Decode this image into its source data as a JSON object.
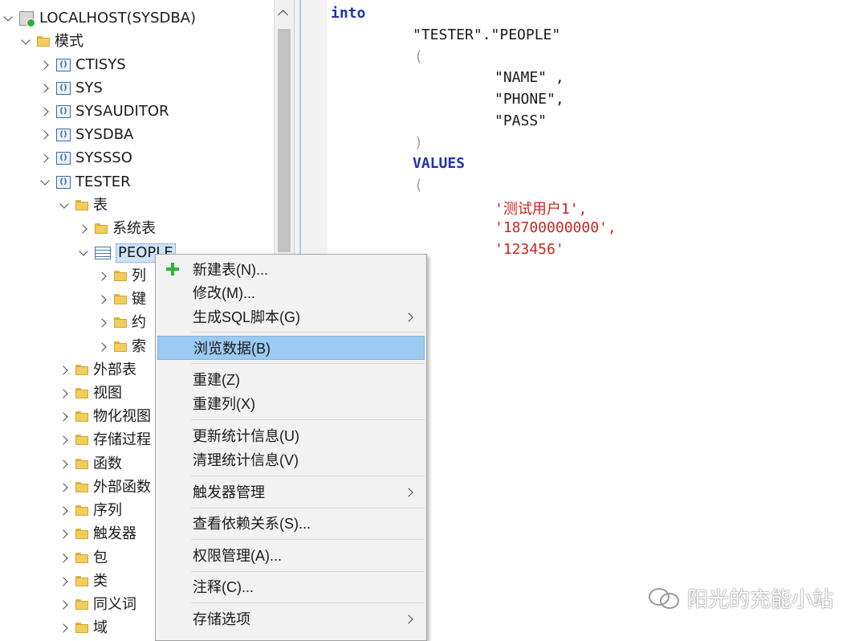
{
  "tree": {
    "root": {
      "label": "LOCALHOST(SYSDBA)",
      "icon": "server-icon"
    },
    "items": [
      {
        "label": "模式",
        "icon": "folder-icon",
        "expanded": true
      },
      {
        "label": "CTISYS",
        "icon": "schema-icon",
        "expanded": false
      },
      {
        "label": "SYS",
        "icon": "schema-icon",
        "expanded": false
      },
      {
        "label": "SYSAUDITOR",
        "icon": "schema-icon",
        "expanded": false
      },
      {
        "label": "SYSDBA",
        "icon": "schema-icon",
        "expanded": false
      },
      {
        "label": "SYSSSO",
        "icon": "schema-icon",
        "expanded": false
      },
      {
        "label": "TESTER",
        "icon": "schema-icon",
        "expanded": true
      },
      {
        "label": "表",
        "icon": "folder-icon",
        "expanded": true
      },
      {
        "label": "系统表",
        "icon": "folder-icon",
        "expanded": false
      },
      {
        "label": "PEOPLE",
        "icon": "table-icon",
        "expanded": true,
        "selected": true
      },
      {
        "label": "列",
        "icon": "folder-icon",
        "expanded": false
      },
      {
        "label": "键",
        "icon": "folder-icon",
        "expanded": false
      },
      {
        "label": "约",
        "icon": "folder-icon",
        "expanded": false
      },
      {
        "label": "索",
        "icon": "folder-icon",
        "expanded": false
      },
      {
        "label": "外部表",
        "icon": "folder-icon",
        "expanded": false
      },
      {
        "label": "视图",
        "icon": "folder-icon",
        "expanded": false
      },
      {
        "label": "物化视图",
        "icon": "folder-icon",
        "expanded": false
      },
      {
        "label": "存储过程",
        "icon": "folder-icon",
        "expanded": false
      },
      {
        "label": "函数",
        "icon": "folder-icon",
        "expanded": false
      },
      {
        "label": "外部函数",
        "icon": "folder-icon",
        "expanded": false
      },
      {
        "label": "序列",
        "icon": "folder-icon",
        "expanded": false
      },
      {
        "label": "触发器",
        "icon": "folder-icon",
        "expanded": false
      },
      {
        "label": "包",
        "icon": "folder-icon",
        "expanded": false
      },
      {
        "label": "类",
        "icon": "folder-icon",
        "expanded": false
      },
      {
        "label": "同义词",
        "icon": "folder-icon",
        "expanded": false
      },
      {
        "label": "域",
        "icon": "folder-icon",
        "expanded": false
      }
    ]
  },
  "editor": {
    "lines": {
      "into": "into",
      "table": "\"TESTER\".\"PEOPLE\"",
      "open1": "(",
      "col1": "\"NAME\" ,",
      "col2": "\"PHONE\",",
      "col3": "\"PASS\"",
      "close1": ")",
      "values": "VALUES",
      "open2": "(",
      "val1": "'测试用户1',",
      "val2": "'18700000000',",
      "val3": "'123456'"
    }
  },
  "context_menu": {
    "items": [
      {
        "label": "新建表(N)...",
        "icon": "plus-icon",
        "submenu": false
      },
      {
        "label": "修改(M)...",
        "submenu": false
      },
      {
        "label": "生成SQL脚本(G)",
        "submenu": true
      },
      {
        "label": "浏览数据(B)",
        "submenu": false,
        "highlighted": true
      },
      {
        "label": "重建(Z)",
        "submenu": false
      },
      {
        "label": "重建列(X)",
        "submenu": false
      },
      {
        "label": "更新统计信息(U)",
        "submenu": false
      },
      {
        "label": "清理统计信息(V)",
        "submenu": false
      },
      {
        "label": "触发器管理",
        "submenu": true
      },
      {
        "label": "查看依赖关系(S)...",
        "submenu": false
      },
      {
        "label": "权限管理(A)...",
        "submenu": false
      },
      {
        "label": "注释(C)...",
        "submenu": false
      },
      {
        "label": "存储选项",
        "submenu": true
      }
    ]
  },
  "watermark": {
    "text": "阳光的充能小站"
  },
  "colors": {
    "keyword": "#1f32b4",
    "string": "#c8281e",
    "highlight": "#9ccaf1",
    "folder": "#f2cd5e"
  }
}
